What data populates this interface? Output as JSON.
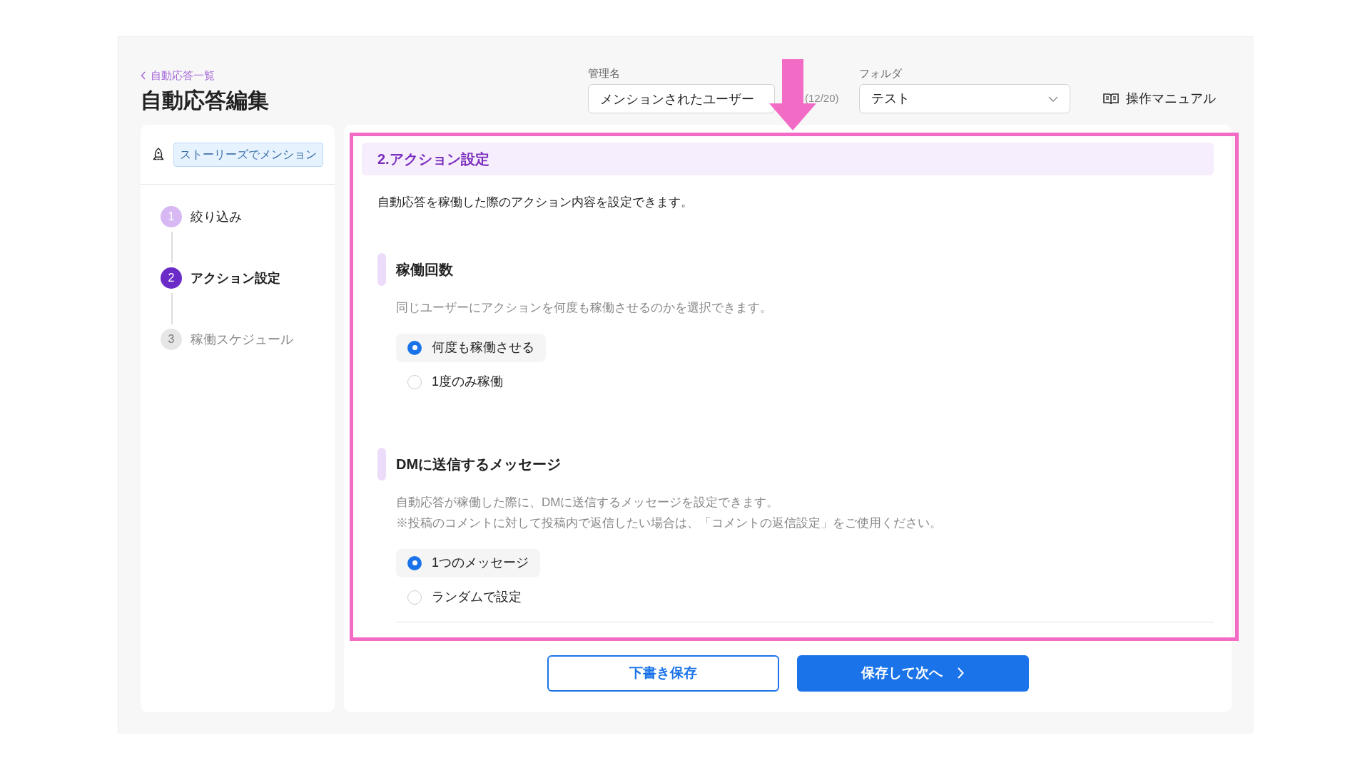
{
  "back_link": {
    "label": "自動応答一覧"
  },
  "page_title": "自動応答編集",
  "name_field": {
    "label": "管理名",
    "value": "メンションされたユーザー",
    "counter": "(12/20)"
  },
  "folder_select": {
    "label": "フォルダ",
    "value": "テスト"
  },
  "manual_link": {
    "label": "操作マニュアル"
  },
  "trigger_tag": "ストーリーズでメンション",
  "steps": [
    {
      "number": "1",
      "label": "絞り込み",
      "kind": "done"
    },
    {
      "number": "2",
      "label": "アクション設定",
      "kind": "current"
    },
    {
      "number": "3",
      "label": "稼働スケジュール",
      "kind": "upcoming"
    }
  ],
  "section": {
    "title": "2.アクション設定",
    "description": "自動応答を稼働した際のアクション内容を設定できます。"
  },
  "groups": [
    {
      "title": "稼働回数",
      "description": [
        "同じユーザーにアクションを何度も稼働させるのかを選択できます。"
      ],
      "options": [
        {
          "label": "何度も稼働させる",
          "selected": true
        },
        {
          "label": "1度のみ稼働",
          "selected": false
        }
      ]
    },
    {
      "title": "DMに送信するメッセージ",
      "description": [
        "自動応答が稼働した際に、DMに送信するメッセージを設定できます。",
        "※投稿のコメントに対して投稿内で返信したい場合は、「コメントの返信設定」をご使用ください。"
      ],
      "options": [
        {
          "label": "1つのメッセージ",
          "selected": true
        },
        {
          "label": "ランダムで設定",
          "selected": false
        }
      ]
    }
  ],
  "buttons": {
    "draft": "下書き保存",
    "next": "保存して次へ"
  }
}
